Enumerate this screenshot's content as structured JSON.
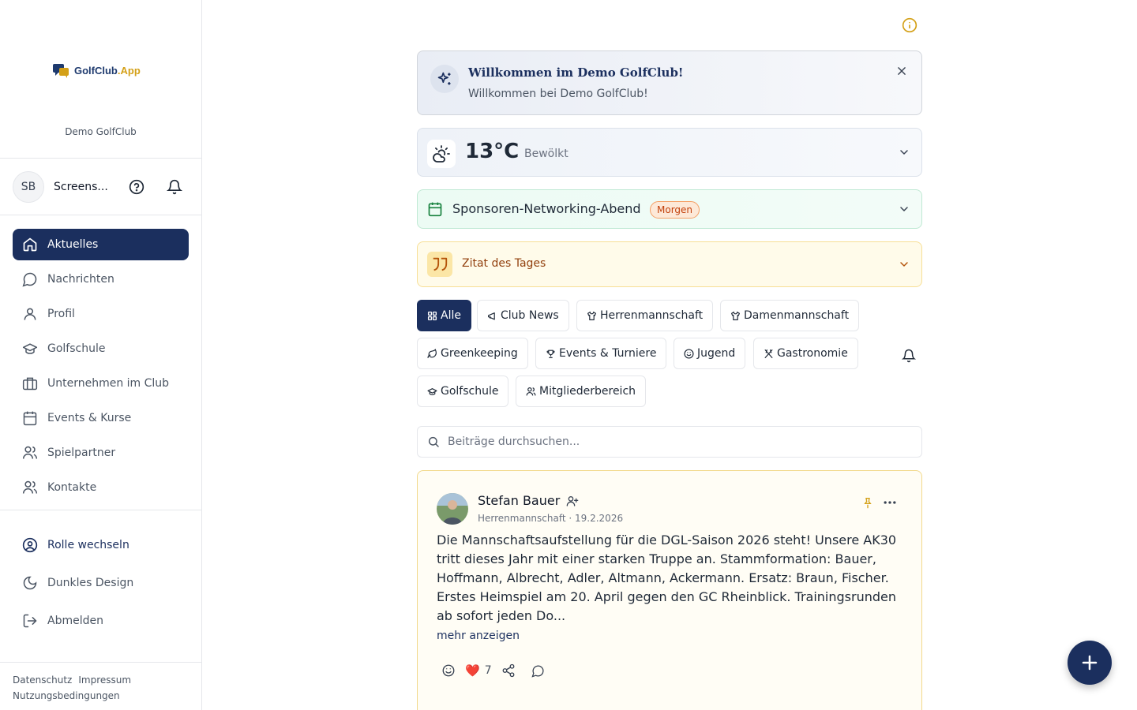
{
  "brand": {
    "name_part1": "GolfClub",
    "name_part2": ".App",
    "club_name": "Demo GolfClub"
  },
  "user": {
    "initials": "SB",
    "name": "Screens..."
  },
  "sidebar": {
    "items": [
      {
        "label": "Aktuelles",
        "icon": "home-icon",
        "active": true
      },
      {
        "label": "Nachrichten",
        "icon": "message-icon"
      },
      {
        "label": "Profil",
        "icon": "user-icon"
      },
      {
        "label": "Golfschule",
        "icon": "graduation-cap-icon"
      },
      {
        "label": "Unternehmen im Club",
        "icon": "briefcase-icon"
      },
      {
        "label": "Events & Kurse",
        "icon": "calendar-icon"
      },
      {
        "label": "Spielpartner",
        "icon": "users-icon"
      },
      {
        "label": "Kontakte",
        "icon": "contacts-icon"
      }
    ],
    "bottom": [
      {
        "label": "Rolle wechseln",
        "icon": "user-circle-icon"
      },
      {
        "label": "Dunkles Design",
        "icon": "moon-icon"
      },
      {
        "label": "Abmelden",
        "icon": "logout-icon"
      }
    ],
    "footer": {
      "privacy": "Datenschutz",
      "imprint": "Impressum",
      "terms": "Nutzungsbedingungen"
    }
  },
  "welcome": {
    "title": "Willkommen im Demo GolfClub!",
    "subtitle": "Willkommen bei Demo GolfClub!"
  },
  "weather": {
    "temp": "13°C",
    "condition": "Bewölkt"
  },
  "event": {
    "title": "Sponsoren-Networking-Abend",
    "badge": "Morgen"
  },
  "quote": {
    "title": "Zitat des Tages"
  },
  "filters": [
    {
      "label": "Alle",
      "active": true
    },
    {
      "label": "Club News"
    },
    {
      "label": "Herrenmannschaft"
    },
    {
      "label": "Damenmannschaft"
    },
    {
      "label": "Greenkeeping"
    },
    {
      "label": "Events & Turniere"
    },
    {
      "label": "Jugend"
    },
    {
      "label": "Gastronomie"
    },
    {
      "label": "Golfschule"
    },
    {
      "label": "Mitgliederbereich"
    }
  ],
  "search": {
    "placeholder": "Beiträge durchsuchen..."
  },
  "post": {
    "author": "Stefan Bauer",
    "meta": "Herrenmannschaft · 19.2.2026",
    "body": "Die Mannschaftsaufstellung für die DGL-Saison 2026 steht! Unsere AK30 tritt dieses Jahr mit einer starken Truppe an. Stammformation: Bauer, Hoffmann, Albrecht, Adler, Altmann, Ackermann. Ersatz: Braun, Fischer. Erstes Heimspiel am 20. April gegen den GC Rheinblick. Trainingsrunden ab sofort jeden Do...",
    "more": "mehr anzeigen",
    "heart_emoji": "❤️",
    "likes": "7"
  },
  "colors": {
    "primary": "#1b2f5e",
    "accent": "#d4a017"
  }
}
